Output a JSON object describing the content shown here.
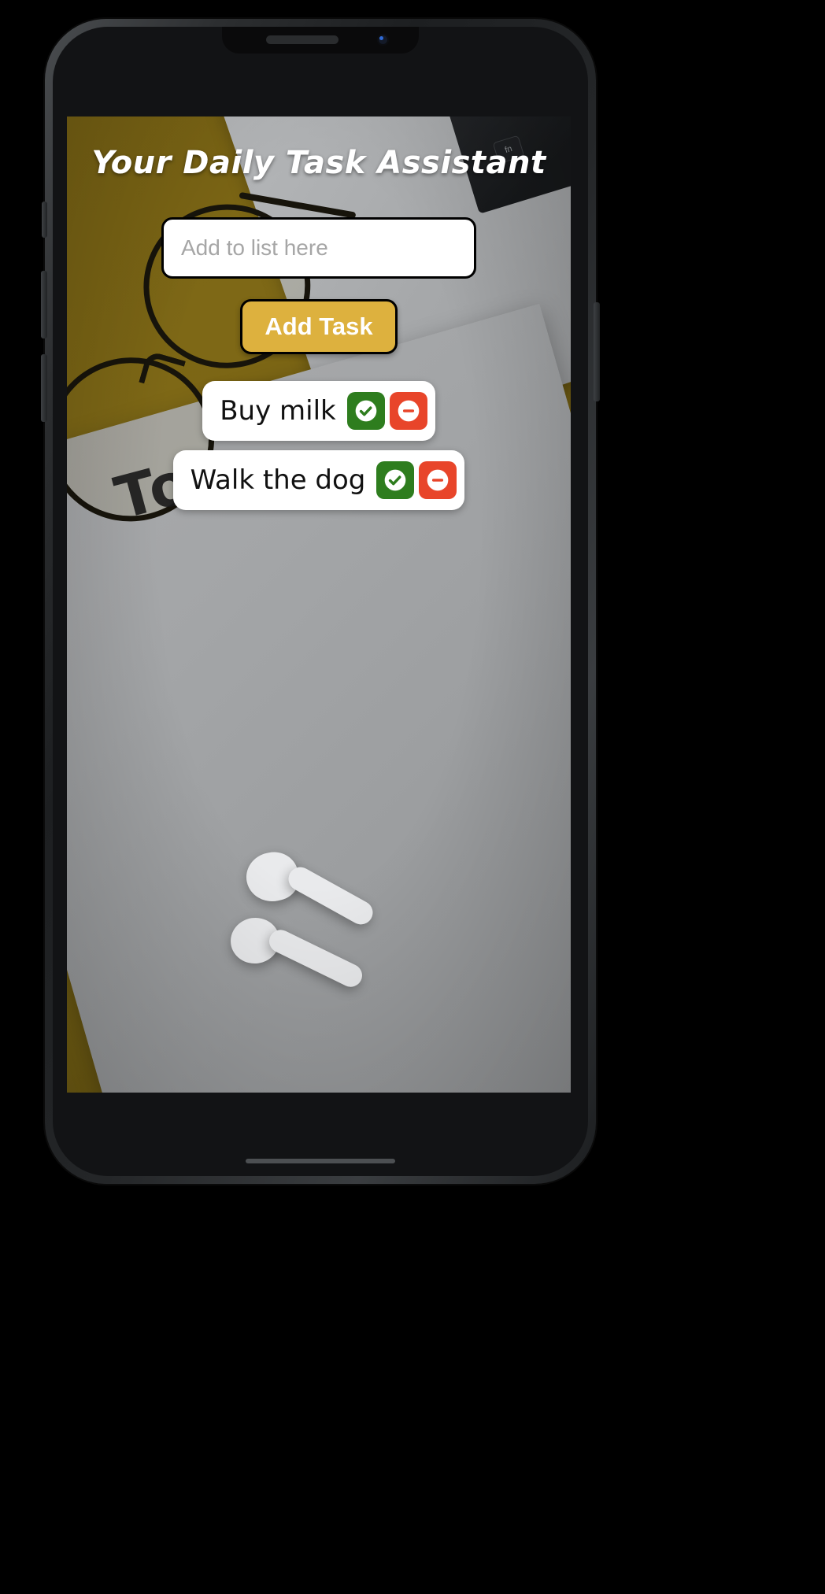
{
  "device": {
    "type": "smartphone-mockup",
    "speaker_icon": "speaker-grille-icon",
    "camera_icon": "front-camera-icon",
    "keycap_label": "fn"
  },
  "app": {
    "title": "Your Daily Task Assistant",
    "input": {
      "placeholder": "Add to list here",
      "value": ""
    },
    "add_button": {
      "label": "Add Task"
    },
    "tasks": [
      {
        "label": "Buy milk",
        "complete_icon": "check-circle-icon",
        "remove_icon": "minus-circle-icon"
      },
      {
        "label": "Walk the dog",
        "complete_icon": "check-circle-icon",
        "remove_icon": "minus-circle-icon"
      }
    ]
  },
  "background": {
    "todo_text": "To",
    "scene": "desk-photo-with-glasses-notebook-earbuds"
  },
  "colors": {
    "background_olive": "#7a6414",
    "paper_gray": "#a3a5a7",
    "accent_gold": "#ddb13e",
    "complete_green": "#2e7d1e",
    "remove_red": "#e8452a",
    "title_white": "#ffffff",
    "placeholder_gray": "#a6a6a6"
  }
}
